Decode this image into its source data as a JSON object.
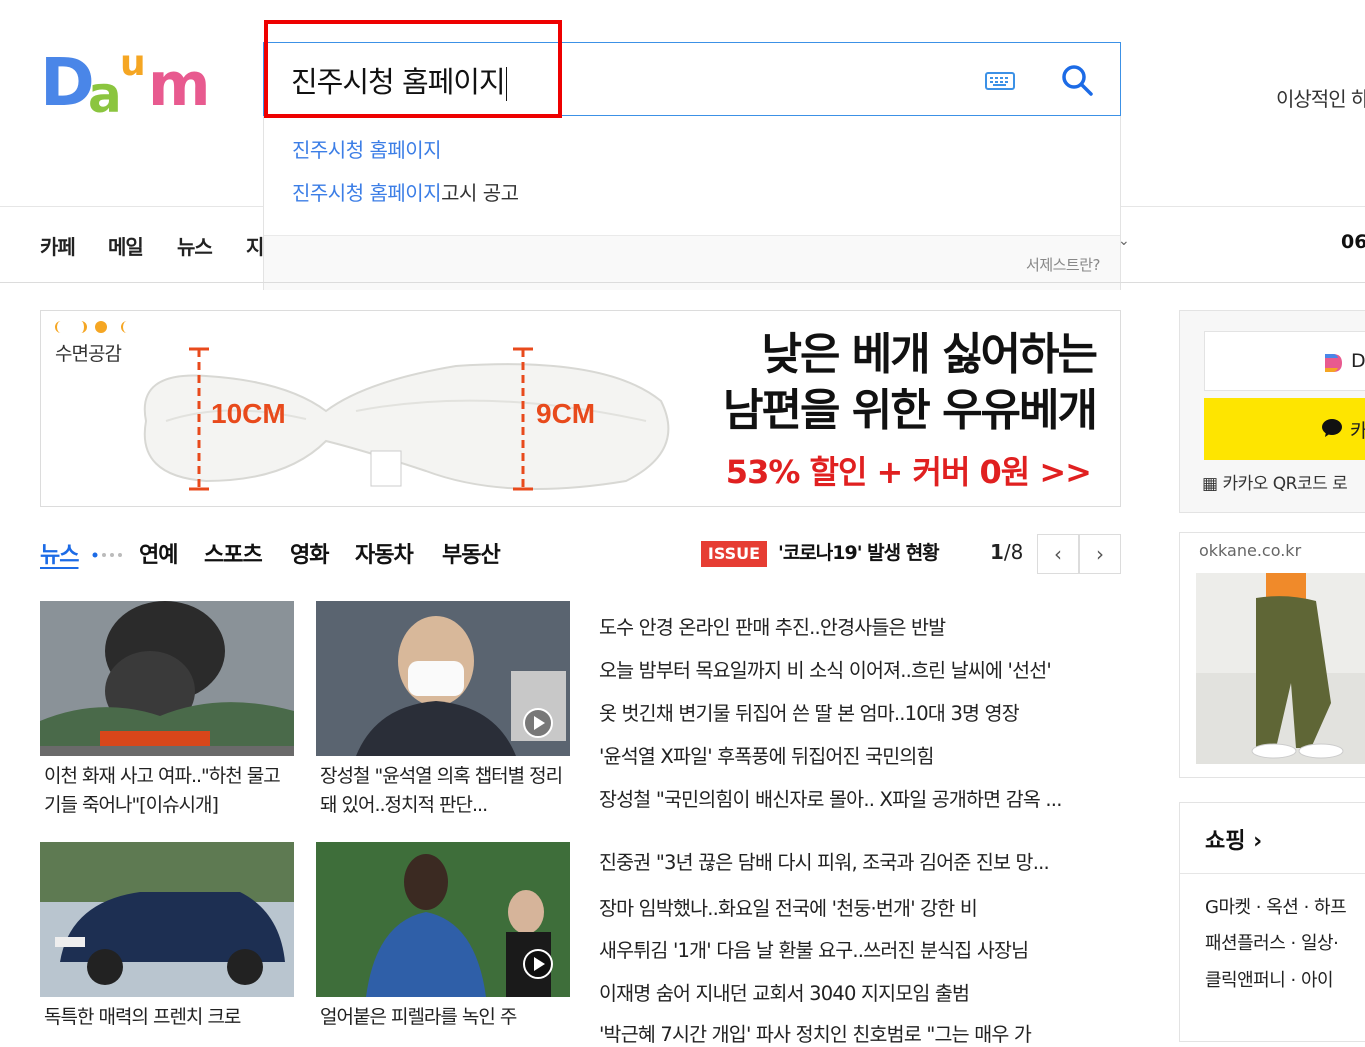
{
  "logo": {
    "text": "Daum"
  },
  "search": {
    "query": "진주시청 홈페이지",
    "keyboard_icon": "keyboard-icon",
    "search_icon": "search-icon"
  },
  "suggestions": {
    "items": [
      {
        "match": "진주시청 홈페이지",
        "rest": ""
      },
      {
        "match": "진주시청 홈페이지",
        "rest": "고시 공고"
      }
    ],
    "help": "서제스트란?"
  },
  "header_right": {
    "text": "이상적인 하"
  },
  "nav": {
    "items": [
      "카페",
      "메일",
      "뉴스",
      "지"
    ],
    "right_num": "06"
  },
  "banner": {
    "brand": "수면공감",
    "measure_left": "10CM",
    "measure_right": "9CM",
    "headline_line1": "낮은 베개 싫어하는",
    "headline_line2": "남편을 위한 우유베개",
    "offer": "53% 할인 + 커버 0원 >>"
  },
  "tabs": {
    "items": [
      "뉴스",
      "연예",
      "스포츠",
      "영화",
      "자동차",
      "부동산"
    ],
    "issue_badge": "ISSUE",
    "issue_text": "'코로나19' 발생 현황",
    "page_current": "1",
    "page_total": "/8",
    "prev": "‹",
    "next": "›"
  },
  "news_cards": [
    {
      "caption": "이천 화재 사고 여파..\"하천 물고기들 죽어나\"[이슈시개]"
    },
    {
      "caption": "장성철 \"윤석열 의혹 챕터별 정리돼 있어..정치적 판단..."
    },
    {
      "caption": "독특한 매력의 프렌치 크로"
    },
    {
      "caption": "얼어붙은 피렐라를 녹인 주"
    }
  ],
  "headlines_group1": [
    "도수 안경 온라인 판매 추진..안경사들은 반발",
    "오늘 밤부터 목요일까지 비 소식 이어져..흐린 날씨에 '선선'",
    "옷 벗긴채 변기물 뒤집어 쓴 딸 본 엄마..10대 3명 영장",
    "'윤석열 X파일' 후폭풍에 뒤집어진 국민의힘",
    "장성철 \"국민의힘이 배신자로 몰아.. X파일 공개하면 감옥 ..."
  ],
  "headlines_group2": [
    "진중권 \"3년 끊은 담배 다시 피워, 조국과 김어준 진보 망...",
    "장마 임박했나..화요일 전국에 '천둥·번개' 강한 비",
    "새우튀김 '1개' 다음 날 환불 요구..쓰러진 분식집 사장님",
    "이재명 숨어 지내던 교회서 3040 지지모임 출범",
    "'박근혜 7시간 개입' 파사 정치인 친호범로 \"그는 매우 가"
  ],
  "right_col": {
    "daum_login": "D",
    "kakao_login": "카",
    "qr_text": "카카오 QR코드 로",
    "ad_url": "okkane.co.kr",
    "shopping_title": "쇼핑",
    "shopping_rows": [
      "G마켓 · 옥션 · 하프",
      "패션플러스 · 일상·",
      "클릭앤퍼니 · 아이"
    ]
  },
  "colors": {
    "accent": "#3c7ee6",
    "red": "#ee0000",
    "kakao": "#fee500",
    "issue": "#e63d33"
  }
}
